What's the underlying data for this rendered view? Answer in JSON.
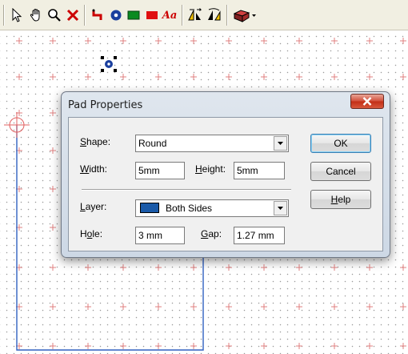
{
  "toolbar": {
    "icons": [
      "select-arrow-icon",
      "pan-hand-icon",
      "zoom-icon",
      "delete-x-icon",
      "track-icon",
      "pad-icon",
      "rectangle-fill-icon",
      "rectangle-red-icon",
      "text-icon",
      "flip-icon",
      "rotate-icon",
      "component-library-icon"
    ],
    "colors": {
      "track": "#cc0000",
      "pad": "#1a3f9e",
      "green": "#0a8a20",
      "red": "#e01010",
      "text": "#cc0000"
    },
    "text_icon_label": "Aa"
  },
  "dialog": {
    "title": "Pad Properties",
    "shape": {
      "label_u": "S",
      "label_rest": "hape:",
      "value": "Round"
    },
    "width": {
      "label_u": "W",
      "label_rest": "idth:",
      "value": "5mm"
    },
    "height": {
      "label_u": "H",
      "label_rest": "eight:",
      "value": "5mm"
    },
    "layer": {
      "label_u": "L",
      "label_rest": "ayer:",
      "value": "Both Sides",
      "swatch_color": "#1a5aa8"
    },
    "hole": {
      "label_pre": "H",
      "label_u": "o",
      "label_rest": "le:",
      "value": "3 mm"
    },
    "gap": {
      "label_u": "G",
      "label_rest": "ap:",
      "value": "1.27 mm"
    },
    "buttons": {
      "ok": "OK",
      "cancel": "Cancel",
      "help_u": "H",
      "help_rest": "elp"
    }
  },
  "colors": {
    "accent_line": "#3060c0",
    "crosshair": "#e06060",
    "grid_cross": "#e08080"
  }
}
